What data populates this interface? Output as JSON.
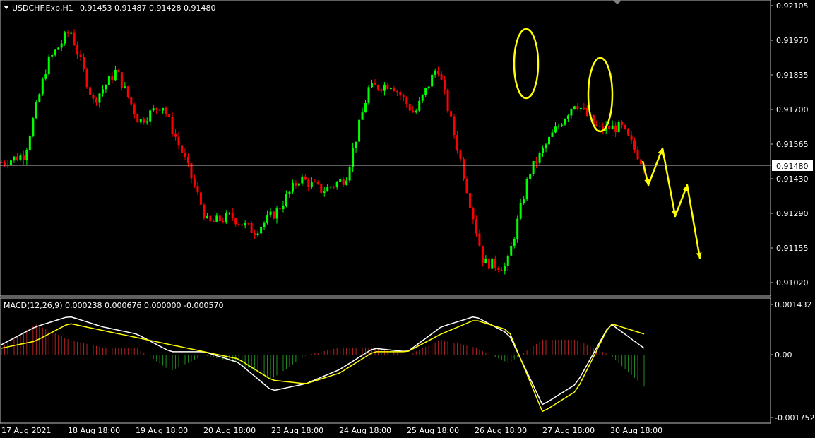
{
  "header": {
    "symbol": "USDCHF.Exp,H1",
    "ohlc": "0.91453 0.91487 0.91428 0.91480"
  },
  "price_axis": {
    "ticks": [
      "0.92105",
      "0.91970",
      "0.91835",
      "0.91700",
      "0.91565",
      "0.91430",
      "0.91290",
      "0.91155",
      "0.91020"
    ],
    "current_price": "0.91480"
  },
  "macd": {
    "label": "MACD(12,26,9) 0.000238 0.000676 0.000000 -0.000570",
    "ticks": [
      "0.001432",
      "0.00",
      "-0.001752"
    ]
  },
  "time_axis": {
    "labels": [
      "17 Aug 2021",
      "18 Aug 18:00",
      "19 Aug 18:00",
      "20 Aug 18:00",
      "23 Aug 18:00",
      "24 Aug 18:00",
      "25 Aug 18:00",
      "26 Aug 18:00",
      "27 Aug 18:00",
      "30 Aug 18:00"
    ]
  },
  "colors": {
    "background": "#000000",
    "bull": "#00ff00",
    "bear": "#ff0000",
    "annotation": "#ffff00",
    "macd_line": "#ffffff",
    "signal_line": "#ffff00",
    "hist_pos": "#b22222",
    "hist_neg": "#228b22",
    "grid": "#c0c0c0"
  },
  "chart_data": [
    {
      "type": "line",
      "title": "USDCHF.Exp,H1",
      "ylim": [
        0.9097,
        0.92125
      ],
      "x": [
        "17 Aug",
        "18 Aug",
        "18 Aug 18:00",
        "19 Aug",
        "19 Aug 18:00",
        "20 Aug",
        "20 Aug 18:00",
        "23 Aug",
        "23 Aug 18:00",
        "24 Aug",
        "24 Aug 18:00",
        "25 Aug",
        "25 Aug 18:00",
        "26 Aug",
        "26 Aug 18:00",
        "27 Aug",
        "27 Aug 18:00",
        "30 Aug",
        "30 Aug 18:00"
      ],
      "series": [
        {
          "values": [
            0.9149,
            0.9152,
            0.9188,
            0.9201,
            0.9173,
            0.9185,
            0.9165,
            0.9172,
            0.915,
            0.9125,
            0.9128,
            0.9122,
            0.913,
            0.9143,
            0.9138,
            0.9143,
            0.9178,
            0.918,
            0.9168,
            0.9187,
            0.915,
            0.911,
            0.9108,
            0.9145,
            0.916,
            0.9173,
            0.9162,
            0.9163,
            0.9148
          ]
        }
      ],
      "annotations": [
        "circle near 26 Aug 18:00 high 0.9198",
        "circle near 27 Aug 18:00 high 0.9187",
        "projected zigzag arrows down to 0.9112"
      ]
    },
    {
      "type": "line",
      "title": "MACD(12,26,9) 0.000238 0.000676 0.000000 -0.000570",
      "ylim": [
        -0.0018,
        0.00145
      ],
      "series": [
        {
          "name": "MACD",
          "values": [
            0.0003,
            0.0008,
            0.0011,
            0.0008,
            0.0006,
            0.0001,
            0.0001,
            -0.0002,
            -0.001,
            -0.0008,
            -0.0004,
            0.0002,
            0.0001,
            0.0008,
            0.0011,
            0.0006,
            -0.0014,
            -0.0008,
            0.0009,
            0.0002
          ]
        },
        {
          "name": "Signal",
          "values": [
            0.0002,
            0.0004,
            0.0009,
            0.0007,
            0.0005,
            0.0003,
            0.0001,
            -0.0001,
            -0.0007,
            -0.0008,
            -0.0005,
            0.0001,
            0.0001,
            0.0006,
            0.001,
            0.0007,
            -0.0016,
            -0.001,
            0.0009,
            0.0006
          ]
        }
      ]
    }
  ]
}
